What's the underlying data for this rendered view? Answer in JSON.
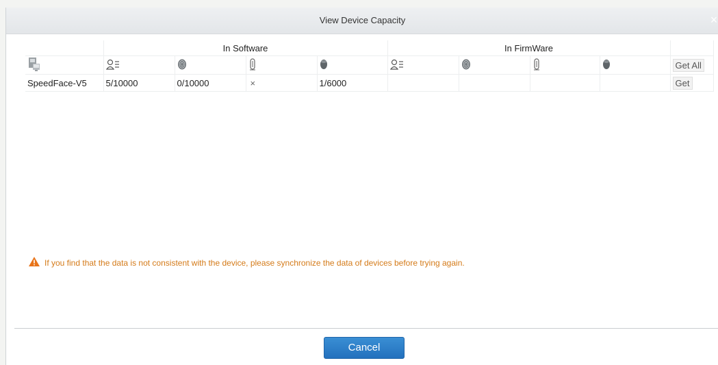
{
  "dialog": {
    "title": "View Device Capacity",
    "close_glyph": "×"
  },
  "table": {
    "group_headers": [
      "In Software",
      "In FirmWare"
    ],
    "icons": {
      "device": "device-icon",
      "user": "user-list-icon",
      "fingerprint": "fingerprint-icon",
      "finger_vein": "finger-vein-icon",
      "face": "face-icon"
    },
    "get_all_label": "Get All",
    "rows": [
      {
        "device": "SpeedFace-V5",
        "software": [
          "5/10000",
          "0/10000",
          "×",
          "1/6000"
        ],
        "firmware": [
          "",
          "",
          "",
          ""
        ],
        "get_label": "Get"
      }
    ]
  },
  "warning": {
    "icon": "warning-triangle-icon",
    "text": "If you find that the data is not consistent with the device, please synchronize the data of devices before trying again."
  },
  "footer": {
    "cancel_label": "Cancel"
  },
  "colors": {
    "accent": "#2a7cc7",
    "warning": "#d47a18"
  }
}
